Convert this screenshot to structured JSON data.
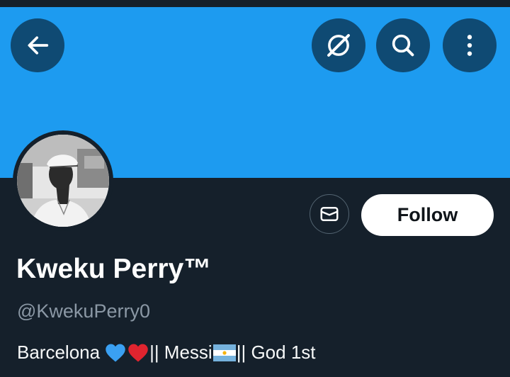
{
  "header": {
    "back_icon": "arrow-left-icon",
    "grok_icon": "grok-icon",
    "search_icon": "search-icon",
    "more_icon": "more-vertical-icon",
    "banner_color": "#1d9bf0",
    "button_color": "#0f4a73"
  },
  "profile": {
    "avatar": "profile-photo",
    "message_icon": "mail-icon",
    "follow_label": "Follow",
    "display_name": "Kweku Perry™",
    "handle": "@KwekuPerry0",
    "bio": {
      "part1": "Barcelona ",
      "emoji1": "blue-heart-icon",
      "emoji2": "red-heart-icon",
      "part2": "|| Messi ",
      "emoji3": "argentina-flag-icon",
      "part3": " || God 1st"
    }
  },
  "theme": {
    "background": "#15202b",
    "text_primary": "#ffffff",
    "text_secondary": "#8b98a5"
  }
}
